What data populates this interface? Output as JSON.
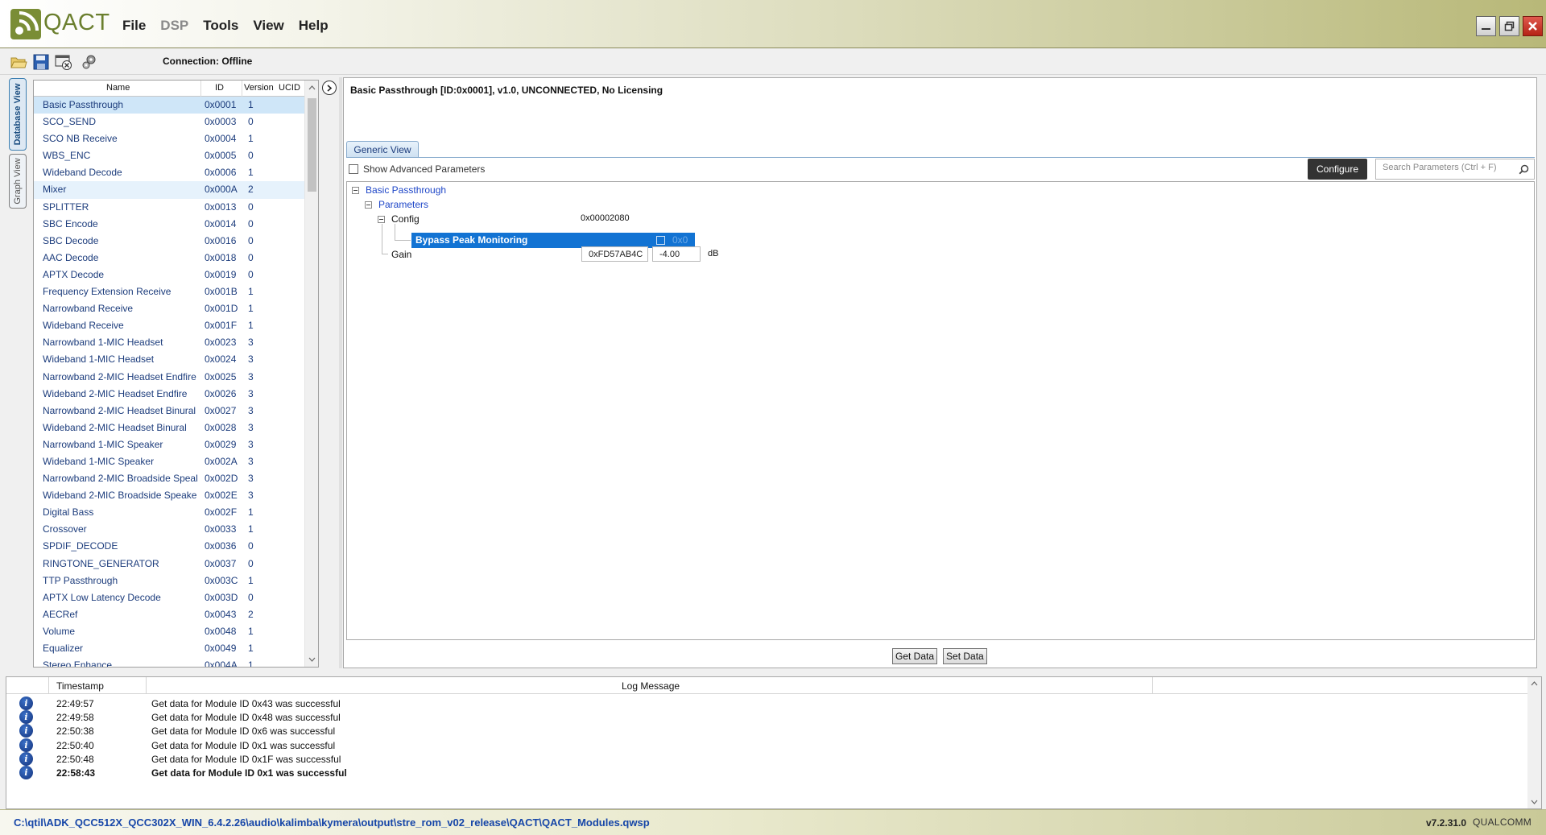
{
  "app": {
    "brand": "QACT",
    "menu": [
      {
        "label": "File",
        "enabled": true
      },
      {
        "label": "DSP",
        "enabled": false
      },
      {
        "label": "Tools",
        "enabled": true
      },
      {
        "label": "View",
        "enabled": true
      },
      {
        "label": "Help",
        "enabled": true
      }
    ],
    "window_buttons": [
      "minimize-icon",
      "restore-icon",
      "close-icon"
    ]
  },
  "toolbar": {
    "icons": [
      "open-folder-icon",
      "save-icon",
      "disconnect-icon",
      "connect-gears-icon"
    ],
    "connection_status": "Connection: Offline"
  },
  "side_tabs": {
    "database": "Database View",
    "graph": "Graph View"
  },
  "module_list": {
    "columns": [
      "Name",
      "ID",
      "Version",
      "UCID"
    ],
    "rows": [
      {
        "name": "Basic Passthrough",
        "id": "0x0001",
        "version": "1",
        "state": "selected"
      },
      {
        "name": "SCO_SEND",
        "id": "0x0003",
        "version": "0"
      },
      {
        "name": "SCO NB Receive",
        "id": "0x0004",
        "version": "1"
      },
      {
        "name": "WBS_ENC",
        "id": "0x0005",
        "version": "0"
      },
      {
        "name": "Wideband Decode",
        "id": "0x0006",
        "version": "1"
      },
      {
        "name": "Mixer",
        "id": "0x000A",
        "version": "2",
        "state": "hover"
      },
      {
        "name": "SPLITTER",
        "id": "0x0013",
        "version": "0"
      },
      {
        "name": "SBC Encode",
        "id": "0x0014",
        "version": "0"
      },
      {
        "name": "SBC Decode",
        "id": "0x0016",
        "version": "0"
      },
      {
        "name": "AAC Decode",
        "id": "0x0018",
        "version": "0"
      },
      {
        "name": "APTX Decode",
        "id": "0x0019",
        "version": "0"
      },
      {
        "name": "Frequency Extension Receive",
        "id": "0x001B",
        "version": "1"
      },
      {
        "name": "Narrowband Receive",
        "id": "0x001D",
        "version": "1"
      },
      {
        "name": "Wideband Receive",
        "id": "0x001F",
        "version": "1"
      },
      {
        "name": "Narrowband 1-MIC Headset",
        "id": "0x0023",
        "version": "3"
      },
      {
        "name": "Wideband 1-MIC Headset",
        "id": "0x0024",
        "version": "3"
      },
      {
        "name": "Narrowband 2-MIC Headset Endfire",
        "id": "0x0025",
        "version": "3"
      },
      {
        "name": "Wideband 2-MIC Headset Endfire",
        "id": "0x0026",
        "version": "3"
      },
      {
        "name": "Narrowband 2-MIC Headset Binural",
        "id": "0x0027",
        "version": "3"
      },
      {
        "name": "Wideband 2-MIC Headset Binural",
        "id": "0x0028",
        "version": "3"
      },
      {
        "name": "Narrowband 1-MIC Speaker",
        "id": "0x0029",
        "version": "3"
      },
      {
        "name": "Wideband 1-MIC Speaker",
        "id": "0x002A",
        "version": "3"
      },
      {
        "name": "Narrowband 2-MIC Broadside Speal",
        "id": "0x002D",
        "version": "3"
      },
      {
        "name": "Wideband 2-MIC Broadside Speake",
        "id": "0x002E",
        "version": "3"
      },
      {
        "name": "Digital Bass",
        "id": "0x002F",
        "version": "1"
      },
      {
        "name": "Crossover",
        "id": "0x0033",
        "version": "1"
      },
      {
        "name": "SPDIF_DECODE",
        "id": "0x0036",
        "version": "0"
      },
      {
        "name": "RINGTONE_GENERATOR",
        "id": "0x0037",
        "version": "0"
      },
      {
        "name": "TTP Passthrough",
        "id": "0x003C",
        "version": "1"
      },
      {
        "name": "APTX Low Latency Decode",
        "id": "0x003D",
        "version": "0"
      },
      {
        "name": "AECRef",
        "id": "0x0043",
        "version": "2"
      },
      {
        "name": "Volume",
        "id": "0x0048",
        "version": "1"
      },
      {
        "name": "Equalizer",
        "id": "0x0049",
        "version": "1"
      },
      {
        "name": "Stereo Enhance",
        "id": "0x004A",
        "version": "1"
      }
    ]
  },
  "module_view": {
    "header": "Basic Passthrough [ID:0x0001], v1.0,  UNCONNECTED, No Licensing",
    "tab": "Generic View",
    "advanced_label": "Show Advanced Parameters",
    "configure_label": "Configure",
    "search_placeholder": "Search Parameters (Ctrl + F)",
    "tree": {
      "root": "Basic Passthrough",
      "group": "Parameters",
      "config_label": "Config",
      "config_value": "0x00002080",
      "bit_label": "Bypass Peak Monitoring",
      "bit_value": "0x0",
      "gain_label": "Gain",
      "gain_hex": "0xFD57AB4C",
      "gain_value": "-4.00",
      "gain_unit": "dB"
    },
    "get_label": "Get Data",
    "set_label": "Set Data"
  },
  "log": {
    "columns": [
      "Timestamp",
      "Log Message"
    ],
    "rows": [
      {
        "time": "22:49:57",
        "message": "Get data for Module ID 0x43 was successful"
      },
      {
        "time": "22:49:58",
        "message": "Get data for Module ID 0x48 was successful"
      },
      {
        "time": "22:50:38",
        "message": "Get data for Module ID 0x6 was successful"
      },
      {
        "time": "22:50:40",
        "message": "Get data for Module ID 0x1 was successful"
      },
      {
        "time": "22:50:48",
        "message": "Get data for Module ID 0x1F was successful"
      },
      {
        "time": "22:58:43",
        "message": "Get data for Module ID 0x1 was successful",
        "bold": true
      }
    ]
  },
  "status": {
    "path": "C:\\qtil\\ADK_QCC512X_QCC302X_WIN_6.4.2.26\\audio\\kalimba\\kymera\\output\\stre_rom_v02_release\\QACT\\QACT_Modules.qwsp",
    "version": "v7.2.31.0",
    "vendor": "QUALCOMM"
  },
  "colors": {
    "accent_green": "#6b7f2e",
    "selection_blue": "#1273d3",
    "link_blue": "#1c3c7c",
    "path_blue": "#1646a8"
  }
}
